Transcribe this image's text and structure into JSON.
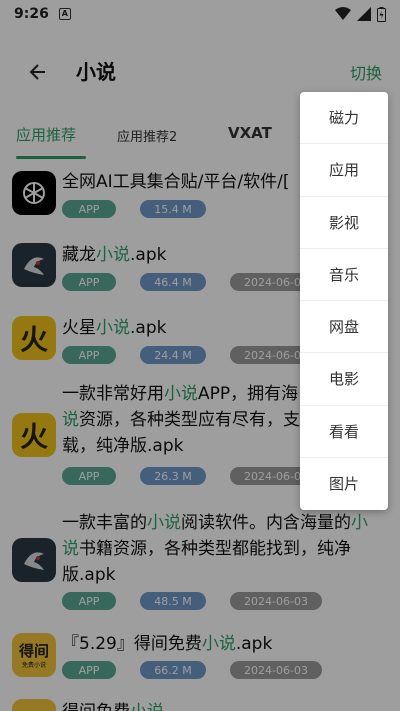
{
  "status": {
    "time": "9:26",
    "notif": "A"
  },
  "header": {
    "title": "小说",
    "switch_label": "切换"
  },
  "tabs": [
    "应用推荐",
    "应用推荐2",
    "VXAT"
  ],
  "items": [
    {
      "title_parts": [
        "全网AI工具集合贴/平台/软件/[",
        "",
        ""
      ],
      "tag": "APP",
      "size": "15.4 M",
      "date": ""
    },
    {
      "title_parts": [
        "藏龙",
        "小说",
        ".apk"
      ],
      "tag": "APP",
      "size": "46.4 M",
      "date": "2024-06-03"
    },
    {
      "title_parts": [
        "火星",
        "小说",
        ".apk"
      ],
      "tag": "APP",
      "size": "24.4 M",
      "date": "2024-06-03"
    },
    {
      "title_line1": "一款非常好用",
      "title_kw1": "小说",
      "title_rest1": "APP，拥有海",
      "title_kw2": "说",
      "title_rest2": "资源，各种类型应有尽有，支",
      "title_line3": "载，纯净版.apk",
      "tag": "APP",
      "size": "26.3 M",
      "date": "2024-06-03"
    },
    {
      "title_line1": "一款丰富的",
      "title_kw1": "小说",
      "title_rest1": "阅读软件。内含海量的",
      "title_kw1b": "小",
      "title_kw2": "说",
      "title_rest2": "书籍资源，各种类型都能找到，纯净",
      "title_line3": "版.apk",
      "tag": "APP",
      "size": "48.5 M",
      "date": "2024-06-03"
    },
    {
      "title_parts": [
        "『5.29』得间免费",
        "小说",
        ".apk"
      ],
      "tag": "APP",
      "size": "66.2 M",
      "date": "2024-06-03"
    },
    {
      "title_parts": [
        "得间免费",
        "小说",
        "..."
      ],
      "tag": "",
      "size": "",
      "date": ""
    }
  ],
  "icons": [
    "openai-icon",
    "canglong-icon",
    "huoxing-icon",
    "huoxing-icon",
    "canglong-icon",
    "dejian-icon",
    "dejian-icon"
  ],
  "icon_dejian_text": "得间",
  "icon_dejian_sub": "免费小说",
  "icon_huo_text": "火",
  "menu": [
    "磁力",
    "应用",
    "影视",
    "音乐",
    "网盘",
    "电影",
    "看看",
    "图片"
  ],
  "colors": {
    "accent": "#2e9e6a",
    "badge_app": "#5aa893",
    "badge_size": "#6e98c7",
    "badge_date": "#9b9b9b"
  }
}
